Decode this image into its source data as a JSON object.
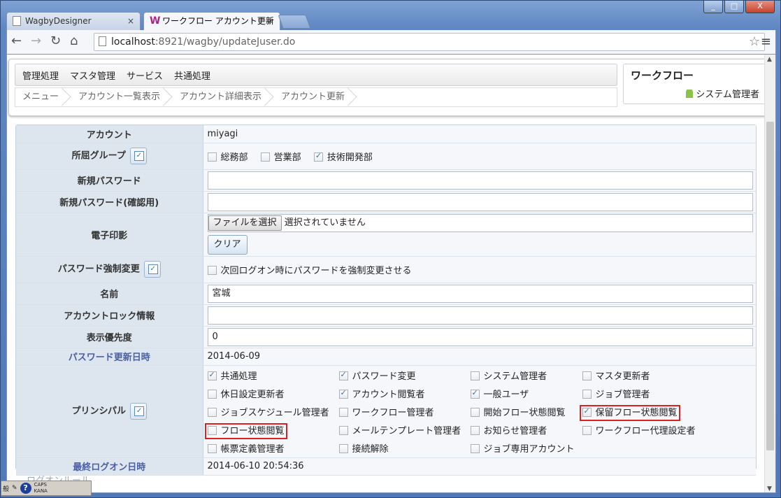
{
  "browser": {
    "tabs": [
      {
        "label": "WagbyDesigner",
        "close": "×"
      },
      {
        "label": "ワークフロー アカウント更新",
        "close": "×"
      }
    ],
    "url_host": "localhost",
    "url_rest": ":8921/wagby/updateJuser.do",
    "window_controls": [
      "_",
      "□",
      "X"
    ]
  },
  "app": {
    "menu": [
      "管理処理",
      "マスタ管理",
      "サービス",
      "共通処理"
    ],
    "breadcrumb": [
      "メニュー",
      "アカウント一覧表示",
      "アカウント詳細表示",
      "アカウント更新"
    ],
    "app_title": "ワークフロー",
    "user": "システム管理者"
  },
  "form": {
    "account_label": "アカウント",
    "account_value": "miyagi",
    "group_label": "所屈グループ",
    "groups": [
      {
        "label": "総務部",
        "checked": false
      },
      {
        "label": "営業部",
        "checked": false
      },
      {
        "label": "技術開発部",
        "checked": true
      }
    ],
    "new_password_label": "新規パスワード",
    "new_password_confirm_label": "新規パスワード(確認用)",
    "seal_label": "電子印影",
    "file_button": "ファイルを選択",
    "file_status": "選択されていません",
    "clear_button": "クリア",
    "force_change_label": "パスワード強制変更",
    "force_change_option": "次回ログオン時にパスワードを強制変更させる",
    "name_label": "名前",
    "name_value": "宮城",
    "lock_label": "アカウントロック情報",
    "lock_value": "",
    "priority_label": "表示優先度",
    "priority_value": "0",
    "pw_updated_label": "パスワード更新日時",
    "pw_updated_value": "2014-06-09",
    "principal_label": "プリンシパル",
    "principals": [
      {
        "label": "共通処理",
        "checked": true
      },
      {
        "label": "パスワード変更",
        "checked": true
      },
      {
        "label": "システム管理者",
        "checked": false
      },
      {
        "label": "マスタ更新者",
        "checked": false
      },
      {
        "label": "休日設定更新者",
        "checked": false
      },
      {
        "label": "アカウント閲覧者",
        "checked": true
      },
      {
        "label": "一般ユーザ",
        "checked": true
      },
      {
        "label": "ジョブ管理者",
        "checked": false
      },
      {
        "label": "ジョブスケジュール管理者",
        "checked": false
      },
      {
        "label": "ワークフロー管理者",
        "checked": false
      },
      {
        "label": "開始フロー状態閲覧",
        "checked": false
      },
      {
        "label": "保留フロー状態閲覧",
        "checked": true,
        "highlight": true
      },
      {
        "label": "フロー状態閲覧",
        "checked": false,
        "highlight": true
      },
      {
        "label": "メールテンプレート管理者",
        "checked": false
      },
      {
        "label": "お知らせ管理者",
        "checked": false
      },
      {
        "label": "ワークフロー代理設定者",
        "checked": false
      },
      {
        "label": "帳票定義管理者",
        "checked": false
      },
      {
        "label": "接続解除",
        "checked": false
      },
      {
        "label": "ジョブ専用アカウント",
        "checked": false
      }
    ],
    "last_logon_label": "最終ログオン日時",
    "last_logon_value": "2014-06-10 20:54:36",
    "partial_label": "ログオンルール"
  },
  "ime": {
    "mode": "般",
    "help": "?",
    "caps": "CAPS",
    "kana": "KANA"
  }
}
